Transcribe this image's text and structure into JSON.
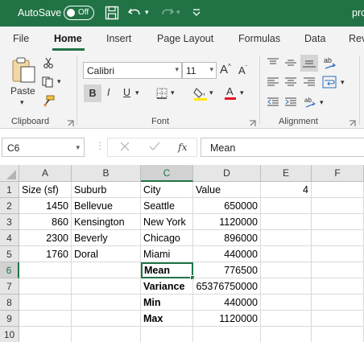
{
  "titlebar": {
    "autosave_label": "AutoSave",
    "autosave_state": "Off",
    "doc_name": "pro"
  },
  "tabs": [
    "File",
    "Home",
    "Insert",
    "Page Layout",
    "Formulas",
    "Data",
    "Rev"
  ],
  "active_tab": "Home",
  "ribbon": {
    "clipboard": {
      "label": "Clipboard",
      "paste_label": "Paste"
    },
    "font": {
      "label": "Font",
      "font_name": "Calibri",
      "font_size": "11",
      "bold": "B",
      "italic": "I",
      "underline": "U"
    },
    "alignment": {
      "label": "Alignment"
    }
  },
  "formula_bar": {
    "name_box": "C6",
    "fx": "fx",
    "formula": "Mean"
  },
  "grid": {
    "columns": [
      "A",
      "B",
      "C",
      "D",
      "E",
      "F"
    ],
    "selected_column": "C",
    "rows": [
      "1",
      "2",
      "3",
      "4",
      "5",
      "6",
      "7",
      "8",
      "9",
      "10"
    ],
    "selected_row": "6",
    "active_cell": "C6",
    "cells": {
      "A1": "Size (sf)",
      "B1": "Suburb",
      "C1": "City",
      "D1": "Value",
      "E1": "4",
      "A2": "1450",
      "B2": "Bellevue",
      "C2": "Seattle",
      "D2": "650000",
      "A3": "860",
      "B3": "Kensington",
      "C3": "New York",
      "D3": "1120000",
      "A4": "2300",
      "B4": "Beverly",
      "C4": "Chicago",
      "D4": "896000",
      "A5": "1760",
      "B5": "Doral",
      "C5": "Miami",
      "D5": "440000",
      "C6": "Mean",
      "D6": "776500",
      "C7": "Variance",
      "D7": "65376750000",
      "C8": "Min",
      "D8": "440000",
      "C9": "Max",
      "D9": "1120000"
    }
  },
  "colors": {
    "brand": "#217346",
    "ribbon_bg": "#f3f3f3",
    "font_color_bar": "#e81123",
    "highlight_bar": "#ffe600"
  }
}
